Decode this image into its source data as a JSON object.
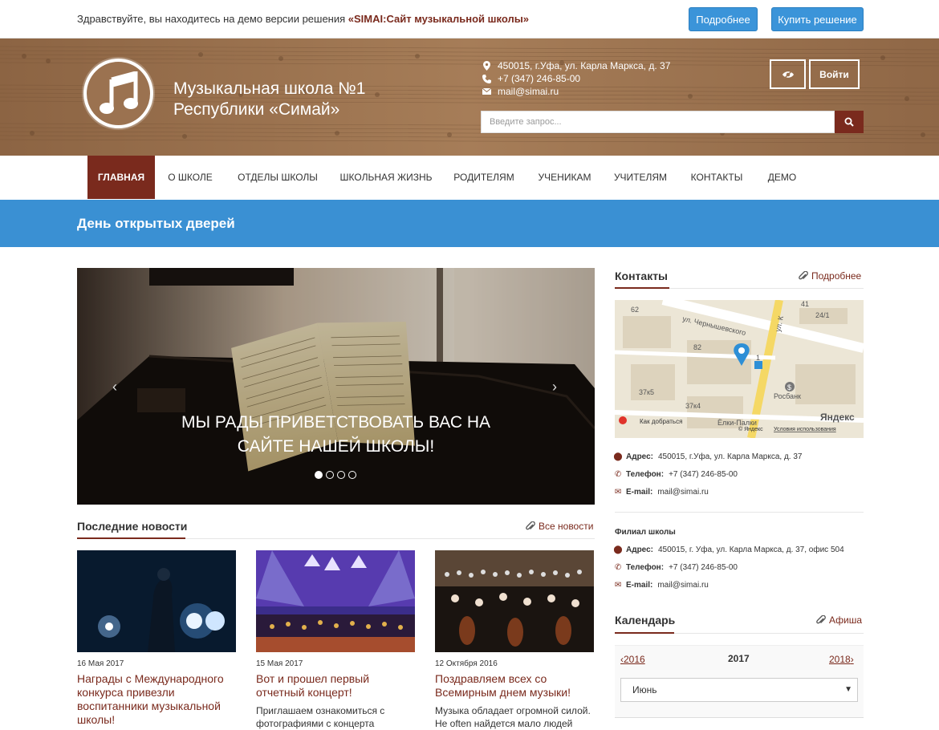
{
  "demo": {
    "text": "Здравствуйте, вы находитесь на демо версии решения ",
    "product": "«SIMAI:Сайт музыкальной школы»",
    "more_label": "Подробнее",
    "buy_label": "Купить решение"
  },
  "header": {
    "name_line1": "Музыкальная школа №1",
    "name_line2": "Республики «Симай»",
    "address": "450015, г.Уфа, ул. Карла Маркса, д. 37",
    "phone": "+7 (347) 246-85-00",
    "email": "mail@simai.ru",
    "login_label": "Войти",
    "search_placeholder": "Введите запрос..."
  },
  "nav": {
    "items": [
      {
        "label": "Главная"
      },
      {
        "label": "О школе"
      },
      {
        "label": "Отделы школы"
      },
      {
        "label": "Школьная жизнь"
      },
      {
        "label": "Родителям"
      },
      {
        "label": "Ученикам"
      },
      {
        "label": "Учителям"
      },
      {
        "label": "Контакты"
      },
      {
        "label": "Демо"
      }
    ]
  },
  "banner": {
    "title": "День открытых дверей"
  },
  "slider": {
    "caption_line1": "Мы рады приветствовать вас на",
    "caption_line2": "сайте нашей школы!",
    "prev": "‹",
    "next": "›"
  },
  "news": {
    "heading": "Последние новости",
    "all_label": "Все новости",
    "items": [
      {
        "date": "16 Мая 2017",
        "title": "Награды с Международного конкурса привезли воспитанники музыкальной школы!",
        "text": ""
      },
      {
        "date": "15 Мая 2017",
        "title": "Вот и прошел первый отчетный концерт!",
        "text": "Приглашаем ознакомиться с фотографиями с концерта"
      },
      {
        "date": "12 Октября 2016",
        "title": "Поздравляем всех со Всемирным днем музыки!",
        "text": "Музыка обладает огромной силой. Не often найдется мало людей"
      }
    ]
  },
  "contacts": {
    "heading": "Контакты",
    "more_label": "Подробнее",
    "map": {
      "street1": "ул. Чернышевского",
      "street2": "ул. К",
      "bank": "Росбанк",
      "cafe": "Ёлки-Палки",
      "route": "Как добраться",
      "brand": "Яндекс",
      "copyright": "© Яндекс",
      "terms": "Условия использования",
      "numbers": [
        "62",
        "82",
        "37к5",
        "37к4",
        "24/1",
        "41",
        "1"
      ]
    },
    "address_label": "Адрес:",
    "address": "450015, г.Уфа, ул. Карла Маркса, д. 37",
    "phone_label": "Телефон:",
    "phone": "+7 (347) 246-85-00",
    "email_label": "E-mail:",
    "email": "mail@simai.ru",
    "branch": {
      "title": "Филиал школы",
      "address": "450015, г. Уфа, ул. Карла Маркса, д. 37, офис 504",
      "phone": "+7 (347) 246-85-00",
      "email": "mail@simai.ru"
    }
  },
  "calendar": {
    "heading": "Календарь",
    "afisha_label": "Афиша",
    "prev_year": "2016",
    "year": "2017",
    "next_year": "2018",
    "month": "Июнь"
  },
  "colors": {
    "brand": "#7a2a1d",
    "header_bg": "#9b7250",
    "accent_blue": "#3a90d3"
  }
}
